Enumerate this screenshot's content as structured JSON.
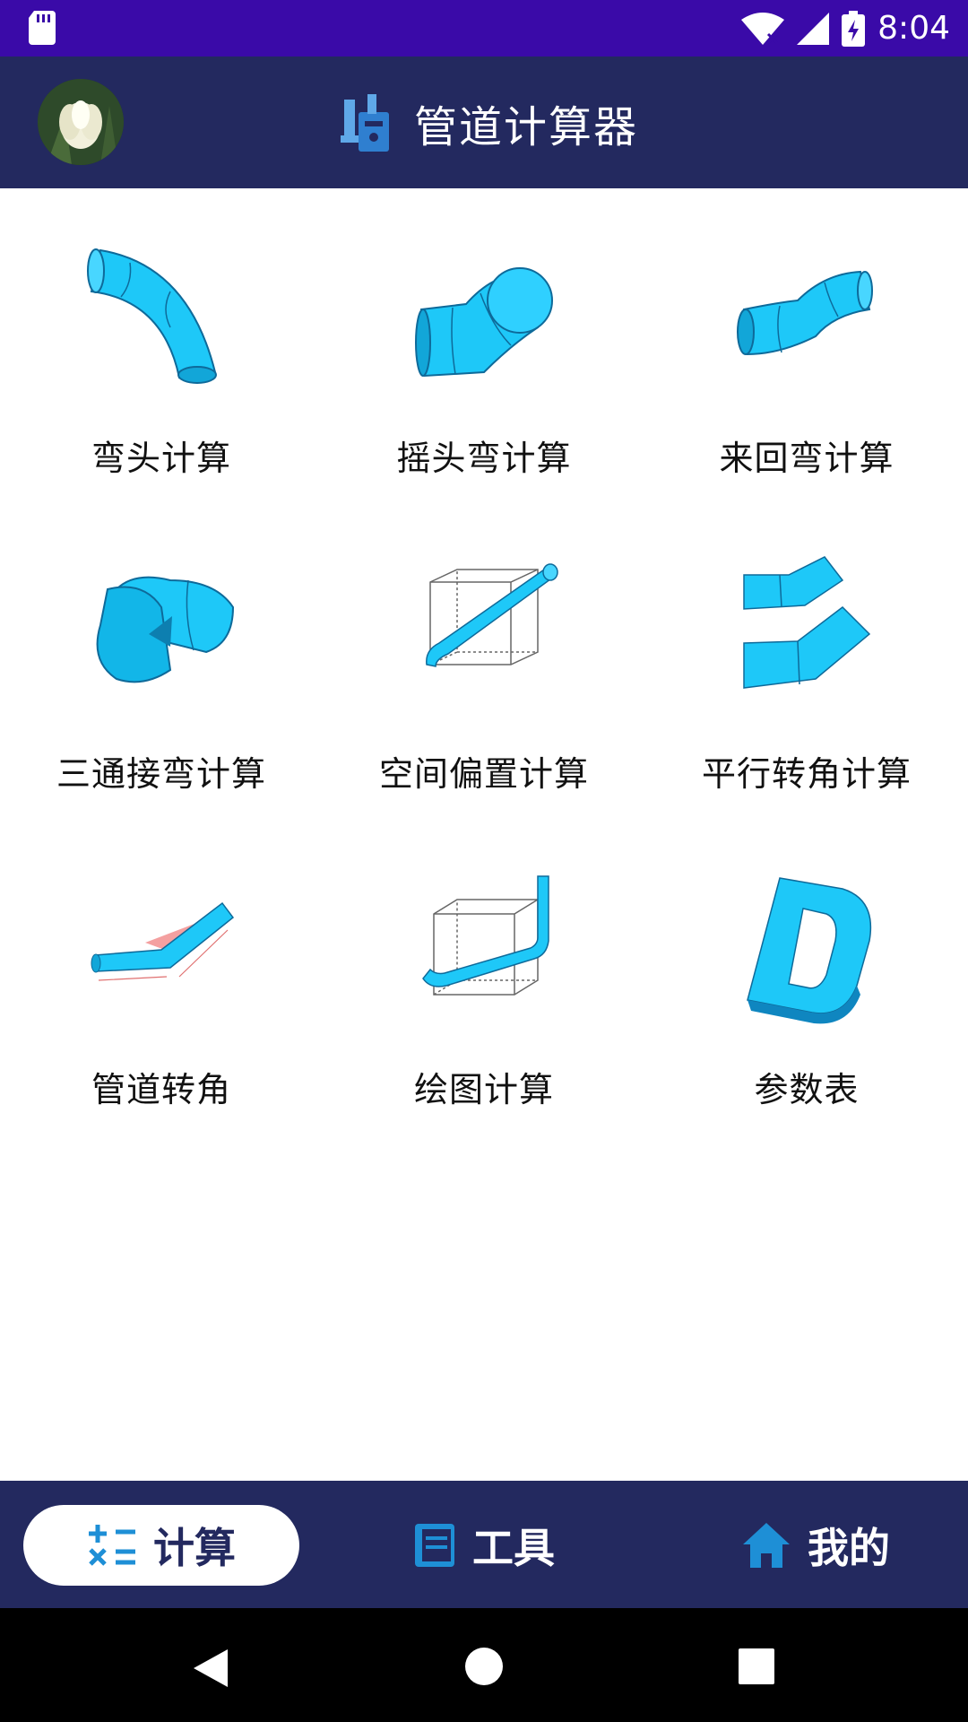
{
  "status_bar": {
    "time": "8:04"
  },
  "app_bar": {
    "title": "管道计算器"
  },
  "tools": [
    {
      "label": "弯头计算",
      "icon": "elbow-pipe-icon"
    },
    {
      "label": "摇头弯计算",
      "icon": "swing-bend-icon"
    },
    {
      "label": "来回弯计算",
      "icon": "offset-bend-icon"
    },
    {
      "label": "三通接弯计算",
      "icon": "tee-elbow-icon"
    },
    {
      "label": "空间偏置计算",
      "icon": "space-offset-icon"
    },
    {
      "label": "平行转角计算",
      "icon": "parallel-turn-icon"
    },
    {
      "label": "管道转角",
      "icon": "pipe-corner-icon"
    },
    {
      "label": "绘图计算",
      "icon": "drawing-calc-icon"
    },
    {
      "label": "参数表",
      "icon": "parameter-table-icon"
    }
  ],
  "bottom_nav": {
    "tabs": [
      {
        "label": "计算",
        "icon": "calculator-icon",
        "active": true
      },
      {
        "label": "工具",
        "icon": "book-icon",
        "active": false
      },
      {
        "label": "我的",
        "icon": "home-icon",
        "active": false
      }
    ]
  },
  "colors": {
    "accent": "#23295f",
    "status_bar": "#3a0aa8",
    "pipe": "#1ec8f8",
    "icon_blue": "#1e8fd6"
  }
}
